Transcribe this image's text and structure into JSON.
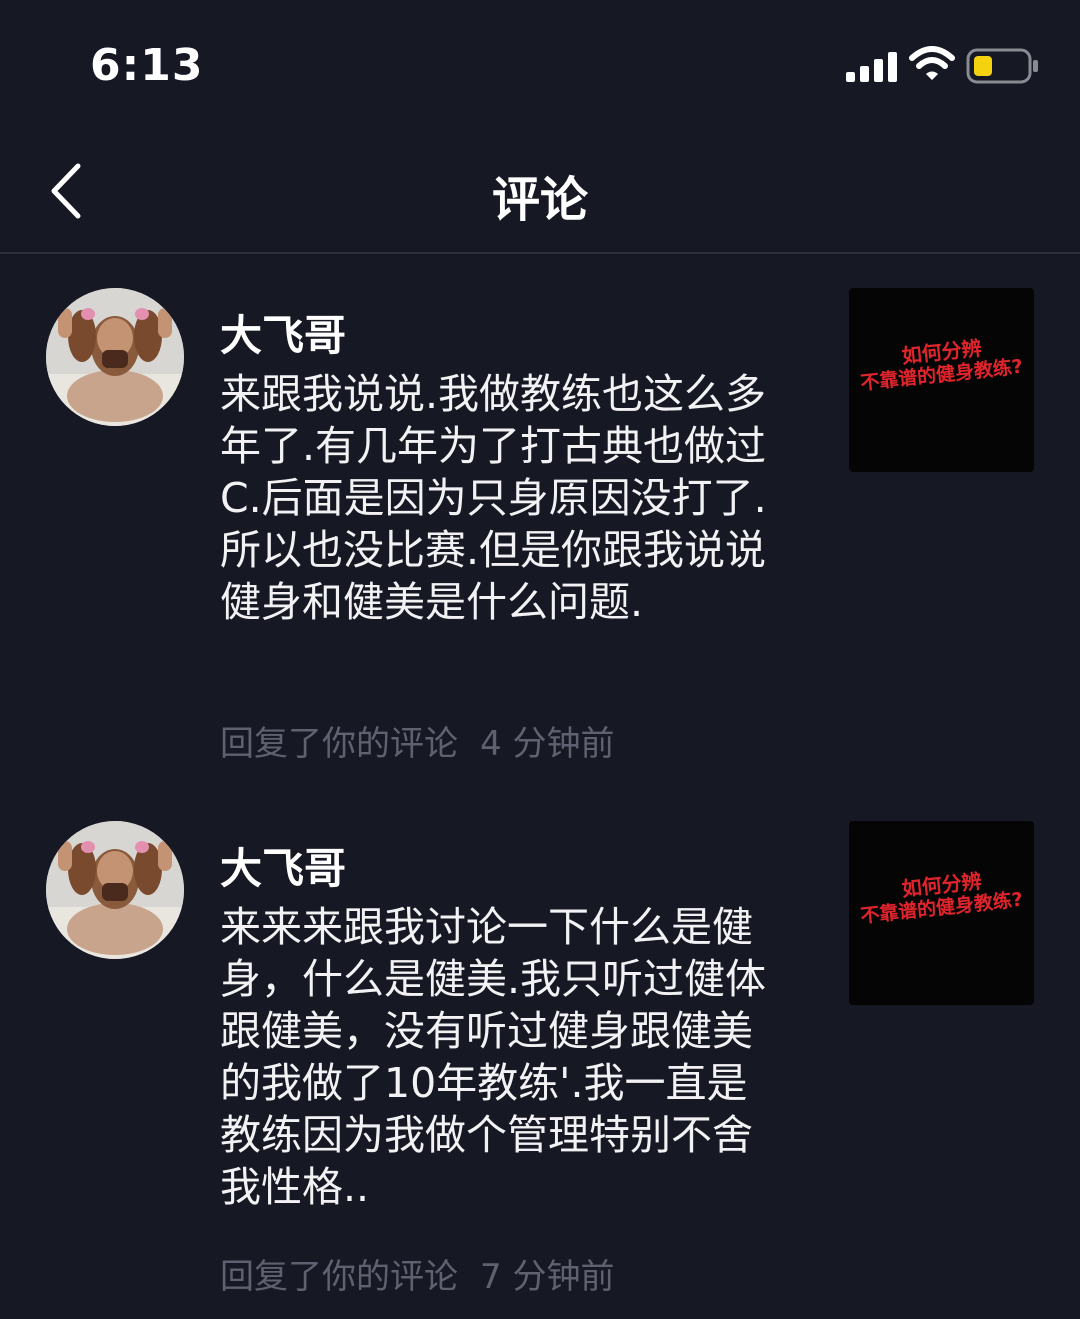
{
  "status_bar": {
    "time": "6:13",
    "battery_color": "#f5d20f"
  },
  "nav": {
    "title": "评论",
    "back_icon": "chevron-left-icon"
  },
  "comments": [
    {
      "username": "大飞哥",
      "text": "来跟我说说.我做教练也这么多年了.有几年为了打古典也做过C.后面是因为只身原因没打了.所以也没比赛.但是你跟我说说健身和健美是什么问题.",
      "action": "回复了你的评论",
      "time": "4 分钟前",
      "thumb_line1": "如何分辨",
      "thumb_line2": "不靠谱的健身教练?"
    },
    {
      "username": "大飞哥",
      "text": "来来来跟我讨论一下什么是健身，什么是健美.我只听过健体跟健美，没有听过健身跟健美的我做了10年教练'.我一直是教练因为我做个管理特别不舍我性格..",
      "action": "回复了你的评论",
      "time": "7 分钟前",
      "thumb_line1": "如何分辨",
      "thumb_line2": "不靠谱的健身教练?"
    }
  ],
  "colors": {
    "background": "#161823",
    "meta_text": "#5f6170",
    "thumb_text": "#e0242c"
  }
}
